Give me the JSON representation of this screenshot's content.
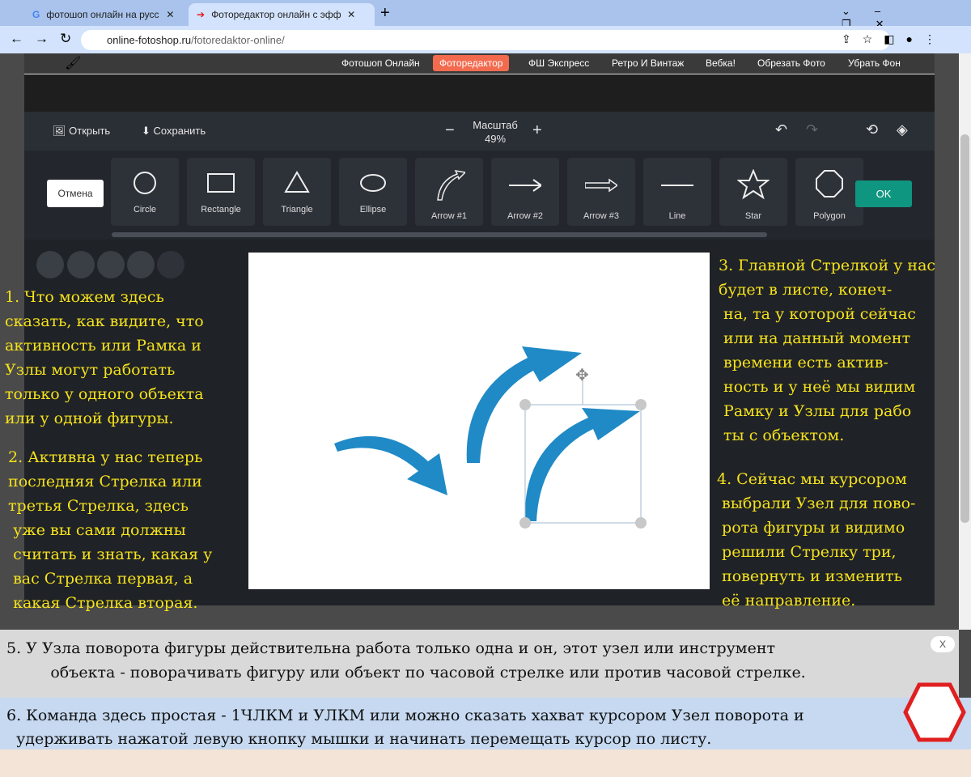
{
  "browser": {
    "tabs": [
      {
        "title": "фотошоп онлайн на русском - Г"
      },
      {
        "title": "Фоторедактор онлайн с эффект"
      }
    ],
    "url_host": "online-fotoshop.ru",
    "url_path": "/fotoredaktor-online/"
  },
  "site_nav": [
    "Фотошоп Онлайн",
    "Фоторедактор",
    "ФШ Экспресс",
    "Ретро И Винтаж",
    "Вебка!",
    "Обрезать Фото",
    "Убрать Фон"
  ],
  "toolbar": {
    "open": "Открыть",
    "save": "Сохранить",
    "zoom_label": "Масштаб",
    "zoom_value": "49%"
  },
  "shapes": {
    "cancel": "Отмена",
    "ok": "OK",
    "items": [
      "Circle",
      "Rectangle",
      "Triangle",
      "Ellipse",
      "Arrow #1",
      "Arrow #2",
      "Arrow #3",
      "Line",
      "Star",
      "Polygon"
    ]
  },
  "colors": {
    "accent": "#f26b4f",
    "ok": "#0f9680",
    "arrow": "#1f8ac6",
    "annotation": "#f5e21b"
  },
  "annotations": {
    "a1": "1. Что можем здесь\nсказать, как видите, что\nактивность или Рамка и\nУзлы могут работать\nтолько у одного объекта\nили у одной фигуры.",
    "a2": " 2. Активна у нас теперь\n последняя Стрелка или\n третья Стрелка, здесь\n  уже вы сами должны\n  считать и знать, какая у\n  вас Стрелка первая, а\n  какая Стрелка вторая.",
    "a3": "3. Главной Стрелкой у нас\nбудет в листе, конеч-\n на, та у которой сейчас\n или на данный момент\n времени есть актив-\n ность и у неё мы видим\n Рамку и Узлы для рабо\n ты с объектом.",
    "a4": "4. Сейчас мы курсором\n выбрали Узел для пово-\n рота фигуры и видимо\n решили Стрелку три,\n повернуть и изменить\n её направление.",
    "a5": "5. У Узла поворота фигуры действительна работа только одна и он, этот узел или инструмент\n         объекта - поворачивать фигуру или объект по часовой стрелке или против часовой стрелке.",
    "a6": "6. Команда здесь простая - 1ЧЛКМ и УЛКМ или можно сказать хахват курсором Узел поворота и\n  удерживать нажатой левую кнопку мышки и начинать перемещать курсор по листу.",
    "close": "X"
  }
}
